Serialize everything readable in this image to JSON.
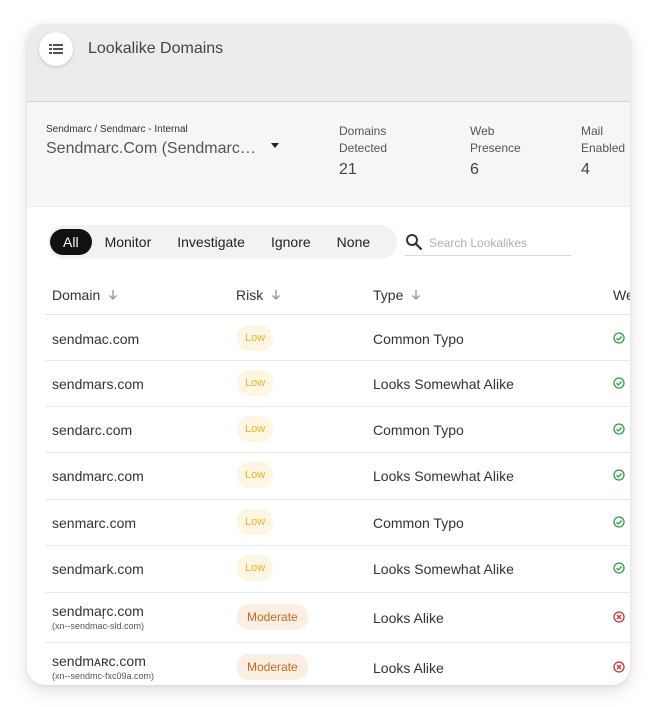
{
  "header": {
    "title": "Lookalike Domains",
    "menu_icon": "list-icon"
  },
  "info": {
    "org_path": "Sendmarc / Sendmarc - Internal",
    "selected_domain": "Sendmarc.Com (Sendmarc.C...",
    "stats": [
      {
        "label_line1": "Domains",
        "label_line2": "Detected",
        "value": "21"
      },
      {
        "label_line1": "Web",
        "label_line2": "Presence",
        "value": "6"
      },
      {
        "label_line1": "Mail",
        "label_line2": "Enabled",
        "value": "4"
      }
    ]
  },
  "filters": {
    "items": [
      "All",
      "Monitor",
      "Investigate",
      "Ignore",
      "None"
    ],
    "active": "All"
  },
  "search": {
    "placeholder": "Search Lookalikes",
    "value": ""
  },
  "table": {
    "headers": [
      "Domain",
      "Risk",
      "Type",
      "We"
    ],
    "rows": [
      {
        "domain": "sendmac.com",
        "punycode": "",
        "risk": "Low",
        "type": "Common Typo",
        "web": "yes"
      },
      {
        "domain": "sendmars.com",
        "punycode": "",
        "risk": "Low",
        "type": "Looks Somewhat Alike",
        "web": "yes"
      },
      {
        "domain": "sendarc.com",
        "punycode": "",
        "risk": "Low",
        "type": "Common Typo",
        "web": "yes"
      },
      {
        "domain": "sandmarc.com",
        "punycode": "",
        "risk": "Low",
        "type": "Looks Somewhat Alike",
        "web": "yes"
      },
      {
        "domain": "senmarc.com",
        "punycode": "",
        "risk": "Low",
        "type": "Common Typo",
        "web": "yes"
      },
      {
        "domain": "sendmark.com",
        "punycode": "",
        "risk": "Low",
        "type": "Looks Somewhat Alike",
        "web": "yes"
      },
      {
        "domain": "sendmaŗc.com",
        "punycode": "(xn--sendmac-sld.com)",
        "risk": "Moderate",
        "type": "Looks Alike",
        "web": "no"
      },
      {
        "domain": "sendmᴀʀc.com",
        "punycode": "(xn--sendmc-fxc09a.com)",
        "risk": "Moderate",
        "type": "Looks Alike",
        "web": "no"
      }
    ]
  },
  "colors": {
    "low_text": "#e8b52a",
    "low_bg": "#fdf6e3",
    "moderate_text": "#c96a1a",
    "moderate_bg": "#fbeee2",
    "ok_green": "#2ea043",
    "error_red": "#d0312d"
  }
}
